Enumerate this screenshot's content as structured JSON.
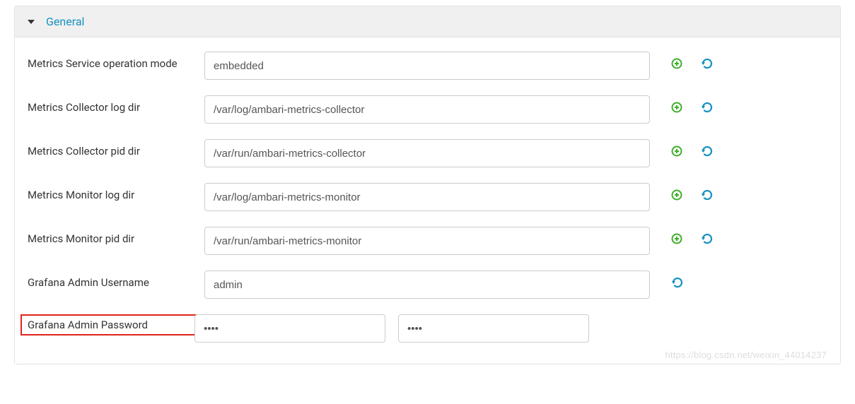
{
  "section": {
    "title": "General"
  },
  "fields": {
    "operation_mode": {
      "label": "Metrics Service operation mode",
      "value": "embedded"
    },
    "collector_log": {
      "label": "Metrics Collector log dir",
      "value": "/var/log/ambari-metrics-collector"
    },
    "collector_pid": {
      "label": "Metrics Collector pid dir",
      "value": "/var/run/ambari-metrics-collector"
    },
    "monitor_log": {
      "label": "Metrics Monitor log dir",
      "value": "/var/log/ambari-metrics-monitor"
    },
    "monitor_pid": {
      "label": "Metrics Monitor pid dir",
      "value": "/var/run/ambari-metrics-monitor"
    },
    "grafana_user": {
      "label": "Grafana Admin Username",
      "value": "admin"
    },
    "grafana_pass": {
      "label": "Grafana Admin Password",
      "value": "••••",
      "confirm": "••••"
    }
  },
  "watermark": "https://blog.csdn.net/weixin_44014237"
}
